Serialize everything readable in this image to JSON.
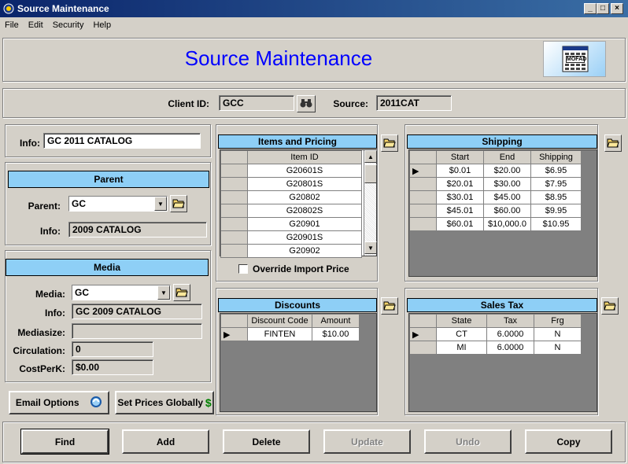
{
  "window": {
    "title": "Source Maintenance",
    "minimize": "_",
    "maximize": "□",
    "close": "×"
  },
  "menu": [
    "File",
    "Edit",
    "Security",
    "Help"
  ],
  "banner": {
    "title": "Source Maintenance",
    "logo_text": "MOFAD"
  },
  "header": {
    "client_id_label": "Client ID:",
    "client_id": "GCC",
    "source_label": "Source:",
    "source": "2011CAT"
  },
  "info": {
    "label": "Info:",
    "value": "GC 2011 CATALOG"
  },
  "parent": {
    "title": "Parent",
    "parent_label": "Parent:",
    "parent_value": "GC",
    "info_label": "Info:",
    "info_value": "2009 CATALOG"
  },
  "media": {
    "title": "Media",
    "media_label": "Media:",
    "media_value": "GC",
    "info_label": "Info:",
    "info_value": "GC 2009 CATALOG",
    "mediasize_label": "Mediasize:",
    "mediasize_value": "",
    "circulation_label": "Circulation:",
    "circulation_value": "0",
    "costperk_label": "CostPerK:",
    "costperk_value": "$0.00"
  },
  "buttons": {
    "email_options": "Email Options",
    "set_prices": "Set Prices Globally",
    "dollar": "$"
  },
  "items": {
    "title": "Items and Pricing",
    "column": "Item ID",
    "rows": [
      "G20601S",
      "G20801S",
      "G20802",
      "G20802S",
      "G20901",
      "G20901S",
      "G20902"
    ],
    "override_label": "Override Import Price"
  },
  "shipping": {
    "title": "Shipping",
    "columns": [
      "Start",
      "End",
      "Shipping"
    ],
    "rows": [
      [
        "$0.01",
        "$20.00",
        "$6.95"
      ],
      [
        "$20.01",
        "$30.00",
        "$7.95"
      ],
      [
        "$30.01",
        "$45.00",
        "$8.95"
      ],
      [
        "$45.01",
        "$60.00",
        "$9.95"
      ],
      [
        "$60.01",
        "$10,000.0",
        "$10.95"
      ]
    ]
  },
  "discounts": {
    "title": "Discounts",
    "columns": [
      "Discount Code",
      "Amount"
    ],
    "rows": [
      [
        "FINTEN",
        "$10.00"
      ]
    ]
  },
  "sales_tax": {
    "title": "Sales Tax",
    "columns": [
      "State",
      "Tax",
      "Frg"
    ],
    "rows": [
      [
        "CT",
        "6.0000",
        "N"
      ],
      [
        "MI",
        "6.0000",
        "N"
      ]
    ]
  },
  "actions": {
    "find": "Find",
    "add": "Add",
    "delete": "Delete",
    "update": "Update",
    "undo": "Undo",
    "copy": "Copy"
  },
  "colors": {
    "header_bg": "#8ecff6",
    "title_blue": "#0000ff",
    "titlebar": "#0a246a",
    "dollar_green": "#008000"
  }
}
